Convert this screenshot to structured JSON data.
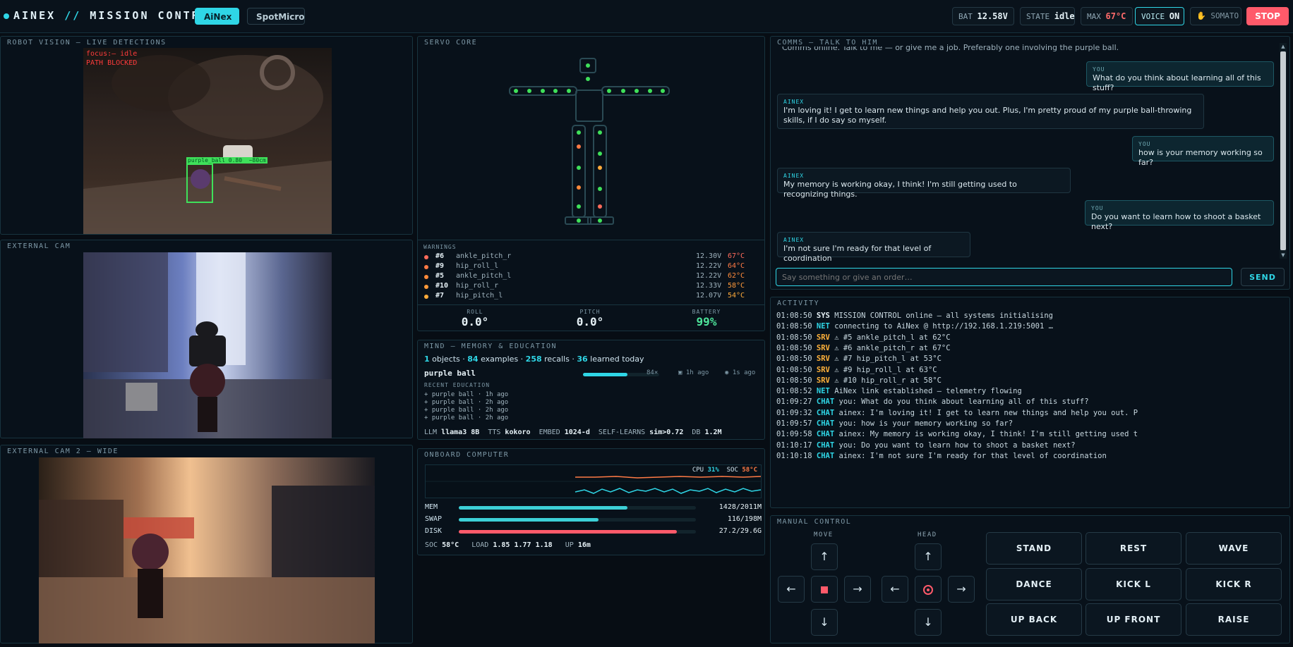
{
  "header": {
    "brand_main": "AINEX",
    "brand_sep": "//",
    "brand_rest": "MISSION CONTROL",
    "tabs": [
      "AiNex",
      "SpotMicro"
    ],
    "bat_label": "BAT",
    "bat_value": "12.58V",
    "state_label": "STATE",
    "state_value": "idle",
    "max_label": "MAX",
    "max_value": "67°C",
    "voice_label": "VOICE",
    "voice_value": "ON",
    "somato_label": "SOMATO",
    "stop_label": "STOP"
  },
  "vision": {
    "title": "ROBOT VISION — LIVE DETECTIONS",
    "focus_text": "focus:— idle",
    "blocked_text": "PATH BLOCKED",
    "detection_label": "purple_ball 0.80  ~80cm"
  },
  "ext_cam": {
    "title": "EXTERNAL CAM"
  },
  "ext_cam2": {
    "title": "EXTERNAL CAM 2 — WIDE"
  },
  "servo": {
    "title": "SERVO CORE",
    "warnings_label": "WARNINGS",
    "warnings": [
      {
        "id": "#6",
        "name": "ankle_pitch_r",
        "volt": "12.30V",
        "temp": "67°C",
        "color": "#ff6b5b"
      },
      {
        "id": "#9",
        "name": "hip_roll_l",
        "volt": "12.22V",
        "temp": "64°C",
        "color": "#ff7a45"
      },
      {
        "id": "#5",
        "name": "ankle_pitch_l",
        "volt": "12.22V",
        "temp": "62°C",
        "color": "#ff8a3a"
      },
      {
        "id": "#10",
        "name": "hip_roll_r",
        "volt": "12.33V",
        "temp": "58°C",
        "color": "#ff9a3a"
      },
      {
        "id": "#7",
        "name": "hip_pitch_l",
        "volt": "12.07V",
        "temp": "54°C",
        "color": "#ffab3a"
      }
    ],
    "roll_label": "ROLL",
    "roll_value": "0.0°",
    "pitch_label": "PITCH",
    "pitch_value": "0.0°",
    "battery_label": "BATTERY",
    "battery_value": "99%"
  },
  "mind": {
    "title": "MIND — MEMORY & EDUCATION",
    "objects": "1",
    "objects_label": "objects ·",
    "examples": "84",
    "examples_label": "examples ·",
    "recalls": "258",
    "recalls_label": "recalls ·",
    "learned": "36",
    "learned_label": "learned today",
    "item_name": "purple ball",
    "item_count": "84×",
    "item_fill": 0.58,
    "item_ago1": "1h ago",
    "item_ago2": "1s ago",
    "recent_label": "RECENT EDUCATION",
    "recent": [
      "+ purple ball · 1h ago",
      "+ purple ball · 2h ago",
      "+ purple ball · 2h ago",
      "+ purple ball · 2h ago"
    ],
    "llm_label": "LLM",
    "llm_value": "llama3 8B",
    "tts_label": "TTS",
    "tts_value": "kokoro",
    "embed_label": "EMBED",
    "embed_value": "1024-d",
    "self_label": "SELF-LEARNS",
    "self_value": "sim>0.72",
    "db_label": "DB",
    "db_value": "1.2M"
  },
  "onboard": {
    "title": "ONBOARD COMPUTER",
    "cpu_label": "CPU",
    "cpu_value": "31%",
    "soc_label": "SOC",
    "soc_value": "58°C",
    "mem_label": "MEM",
    "mem_value": "1428/2011M",
    "mem_fill": 0.71,
    "swap_label": "SWAP",
    "swap_value": "116/198M",
    "swap_fill": 0.59,
    "disk_label": "DISK",
    "disk_value": "27.2/29.6G",
    "disk_fill": 0.92,
    "footer_soc_label": "SOC",
    "footer_soc_value": "58°C",
    "load_label": "LOAD",
    "load_value": "1.85 1.77 1.18",
    "up_label": "UP",
    "up_value": "16m"
  },
  "comms": {
    "title": "COMMS — TALK TO HIM",
    "clipped_line": "Comms online. Talk to me — or give me a job. Preferably one involving the purple ball.",
    "messages": [
      {
        "who": "YOU",
        "text": "What do you think about learning all of this stuff?"
      },
      {
        "who": "AINEX",
        "text": "I'm loving it! I get to learn new things and help you out. Plus, I'm pretty proud of my purple ball-throwing skills, if I do say so myself."
      },
      {
        "who": "YOU",
        "text": "how is your memory working so far?"
      },
      {
        "who": "AINEX",
        "text": "My memory is working okay, I think! I'm still getting used to recognizing things."
      },
      {
        "who": "YOU",
        "text": "Do you want to learn how to shoot a basket next?"
      },
      {
        "who": "AINEX",
        "text": "I'm not sure I'm ready for that level of coordination"
      }
    ],
    "input_placeholder": "Say something or give an order…",
    "send_label": "SEND"
  },
  "activity": {
    "title": "ACTIVITY",
    "entries": [
      {
        "time": "01:08:50",
        "tag": "SYS",
        "msg": "MISSION CONTROL online — all systems initialising",
        "color": "#e6f1f6"
      },
      {
        "time": "01:08:50",
        "tag": "NET",
        "msg": "connecting to AiNex @ http://192.168.1.219:5001 …",
        "color": "#2fd6e6"
      },
      {
        "time": "01:08:50",
        "tag": "SRV",
        "msg": "⚠ #5 ankle_pitch_l at 62°C",
        "color": "#ffb13a"
      },
      {
        "time": "01:08:50",
        "tag": "SRV",
        "msg": "⚠ #6 ankle_pitch_r at 67°C",
        "color": "#ffb13a"
      },
      {
        "time": "01:08:50",
        "tag": "SRV",
        "msg": "⚠ #7 hip_pitch_l at 53°C",
        "color": "#ffb13a"
      },
      {
        "time": "01:08:50",
        "tag": "SRV",
        "msg": "⚠ #9 hip_roll_l at 63°C",
        "color": "#ffb13a"
      },
      {
        "time": "01:08:50",
        "tag": "SRV",
        "msg": "⚠ #10 hip_roll_r at 58°C",
        "color": "#ffb13a"
      },
      {
        "time": "01:08:52",
        "tag": "NET",
        "msg": "AiNex link established — telemetry flowing",
        "color": "#2fd6e6"
      },
      {
        "time": "01:09:27",
        "tag": "CHAT",
        "msg": "you: What do you think about learning all of this stuff?",
        "color": "#2fd6e6"
      },
      {
        "time": "01:09:32",
        "tag": "CHAT",
        "msg": "ainex: I'm loving it! I get to learn new things and help you out. P",
        "color": "#2fd6e6"
      },
      {
        "time": "01:09:57",
        "tag": "CHAT",
        "msg": "you: how is your memory working so far?",
        "color": "#2fd6e6"
      },
      {
        "time": "01:09:58",
        "tag": "CHAT",
        "msg": "ainex: My memory is working okay, I think! I'm still getting used t",
        "color": "#2fd6e6"
      },
      {
        "time": "01:10:17",
        "tag": "CHAT",
        "msg": "you: Do you want to learn how to shoot a basket next?",
        "color": "#2fd6e6"
      },
      {
        "time": "01:10:18",
        "tag": "CHAT",
        "msg": "ainex: I'm not sure I'm ready for that level of coordination",
        "color": "#2fd6e6"
      }
    ]
  },
  "manual": {
    "title": "MANUAL CONTROL",
    "move_label": "MOVE",
    "head_label": "HEAD",
    "actions": [
      "STAND",
      "REST",
      "WAVE",
      "DANCE",
      "KICK L",
      "KICK R",
      "UP BACK",
      "UP FRONT",
      "RAISE"
    ]
  },
  "colors": {
    "accent": "#2fd6e6",
    "danger": "#ff5a6a",
    "warn": "#ffb13a",
    "ok": "#4ee39a"
  }
}
